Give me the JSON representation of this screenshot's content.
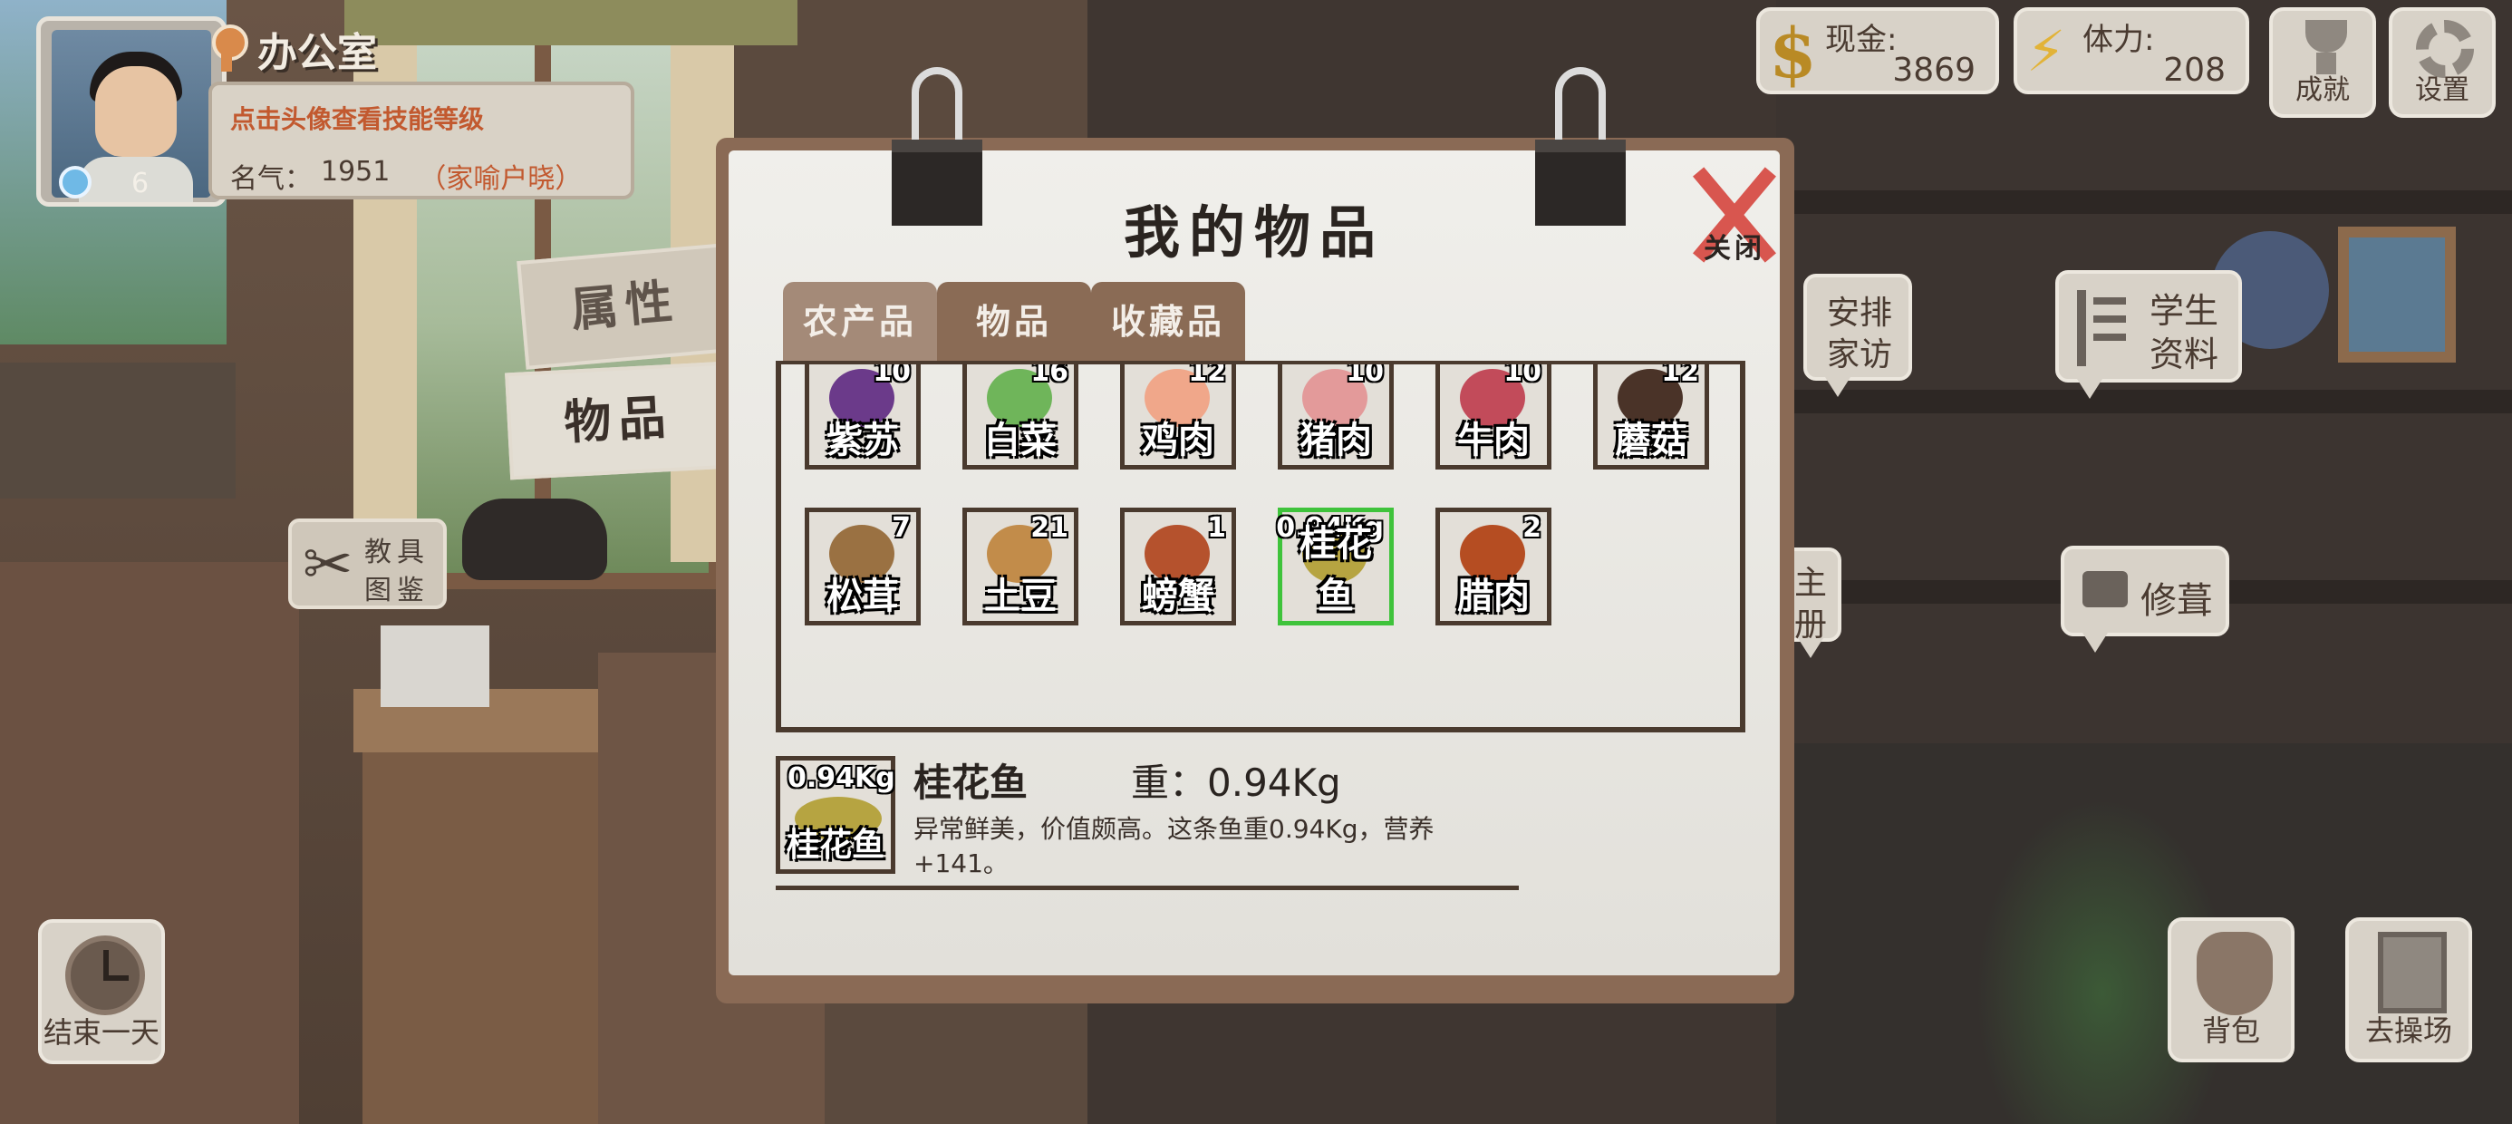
{
  "location": {
    "label": "办公室"
  },
  "player": {
    "hint": "点击头像查看技能等级",
    "fame_label": "名气：",
    "fame_value": "1951",
    "title": "（家喻户晓）",
    "skill_level": "6"
  },
  "resources": {
    "cash": {
      "label": "现金:",
      "value": "3869",
      "icon": "coin-icon"
    },
    "stamina": {
      "label": "体力:",
      "value": "208",
      "icon": "lightning-icon"
    }
  },
  "top_buttons": {
    "achievements": "成就",
    "settings": "设置"
  },
  "side_tabs": {
    "attributes": "属性",
    "items": "物品"
  },
  "tool_guide": {
    "line1": "教具",
    "line2": "图鉴"
  },
  "right_buttons": {
    "home_visit_line1": "安排",
    "home_visit_line2": "家访",
    "student_info_line1": "学生",
    "student_info_line2": "资料",
    "register_line1": "主",
    "register_line2": "册",
    "repair": "修葺"
  },
  "bottom_buttons": {
    "end_day": "结束一天",
    "backpack": "背包",
    "playground": "去操场"
  },
  "dialog": {
    "title": "我的物品",
    "close_label": "关闭",
    "tabs": [
      "农产品",
      "物品",
      "收藏品"
    ],
    "active_tab": "农产品",
    "items": [
      {
        "name": "紫苏",
        "count": "10",
        "color": "#6b3a8a"
      },
      {
        "name": "白菜",
        "count": "16",
        "color": "#6fb55a"
      },
      {
        "name": "鸡肉",
        "count": "12",
        "color": "#f0a78a"
      },
      {
        "name": "猪肉",
        "count": "10",
        "color": "#e39a9a"
      },
      {
        "name": "牛肉",
        "count": "10",
        "color": "#c24b5a"
      },
      {
        "name": "蘑菇",
        "count": "12",
        "color": "#4a3328"
      },
      {
        "name": "松茸",
        "count": "7",
        "color": "#9a7142"
      },
      {
        "name": "土豆",
        "count": "21",
        "color": "#c28c4a"
      },
      {
        "name": "螃蟹",
        "count": "1",
        "color": "#b5522d"
      },
      {
        "name": "桂花鱼",
        "count": "0.94Kg",
        "color": "#b6a441",
        "selected": true
      },
      {
        "name": "腊肉",
        "count": "2",
        "color": "#b54d22"
      }
    ],
    "detail": {
      "thumb_count": "0.94Kg",
      "thumb_name": "桂花鱼",
      "name": "桂花鱼",
      "weight": "重：0.94Kg",
      "description": "异常鲜美，价值颇高。这条鱼重0.94Kg，营养+141。"
    }
  },
  "colors": {
    "accent_red": "#c2592f",
    "selected_border": "#3fc33b",
    "tab_brown": "#8a6b55"
  }
}
